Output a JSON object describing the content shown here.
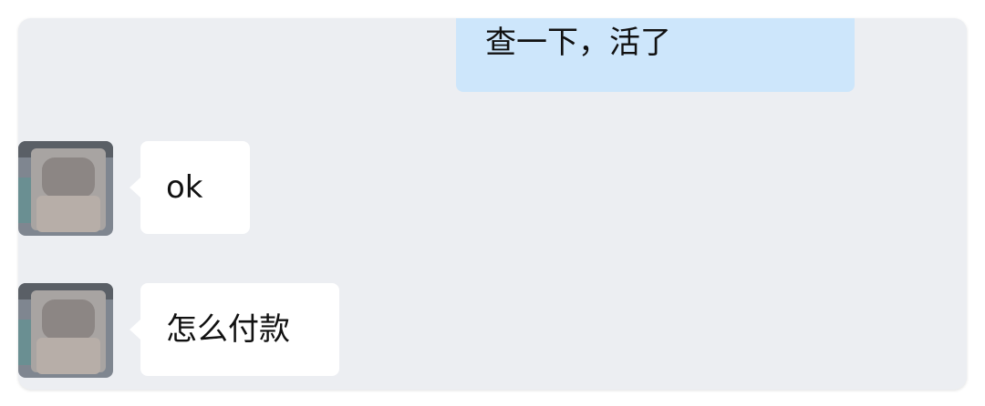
{
  "chat": {
    "messages": [
      {
        "direction": "outgoing",
        "text": "查一下，活了"
      },
      {
        "direction": "incoming",
        "text": "ok"
      },
      {
        "direction": "incoming",
        "text": "怎么付款"
      }
    ]
  },
  "colors": {
    "background": "#eceef2",
    "outgoing_bubble": "#cde6fb",
    "incoming_bubble": "#ffffff"
  }
}
